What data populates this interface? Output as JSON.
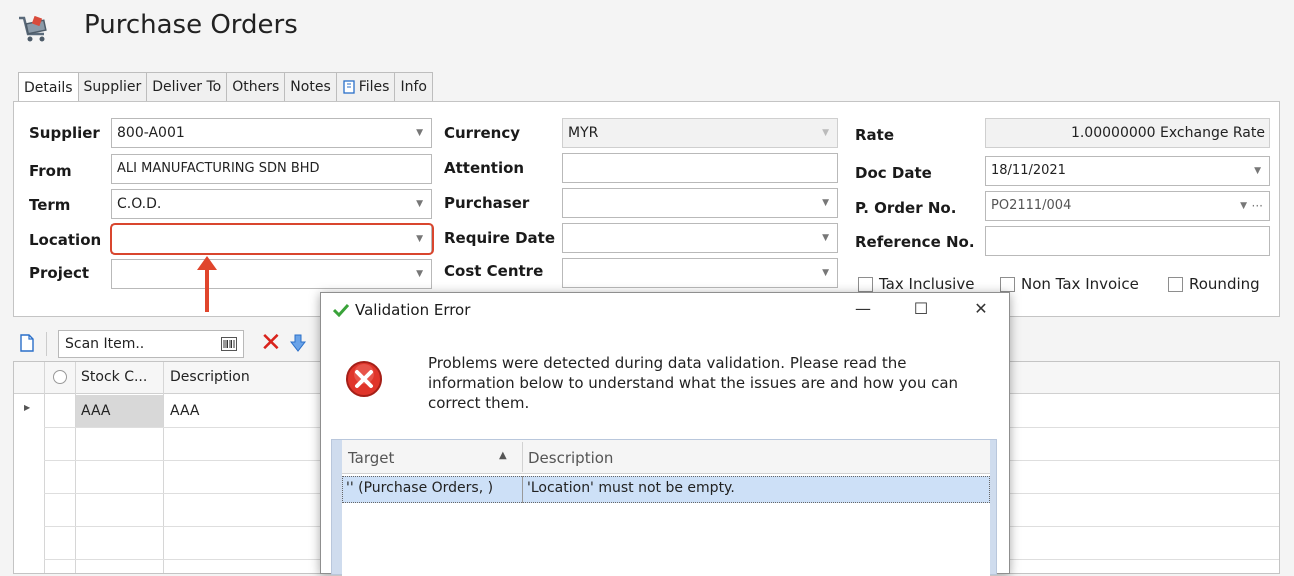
{
  "page": {
    "title": "Purchase Orders"
  },
  "tabs": [
    {
      "label": "Details",
      "active": true
    },
    {
      "label": "Supplier"
    },
    {
      "label": "Deliver To"
    },
    {
      "label": "Others"
    },
    {
      "label": "Notes"
    },
    {
      "label": "Files",
      "icon": "paperclip-icon"
    },
    {
      "label": "Info"
    }
  ],
  "form": {
    "supplier": {
      "label": "Supplier",
      "value": "800-A001"
    },
    "from": {
      "label": "From",
      "value": "ALI MANUFACTURING SDN BHD"
    },
    "term": {
      "label": "Term",
      "value": "C.O.D."
    },
    "location": {
      "label": "Location",
      "value": ""
    },
    "project": {
      "label": "Project",
      "value": ""
    },
    "currency": {
      "label": "Currency",
      "value": "MYR"
    },
    "attention": {
      "label": "Attention",
      "value": ""
    },
    "purchaser": {
      "label": "Purchaser",
      "value": ""
    },
    "require_date": {
      "label": "Require Date",
      "value": ""
    },
    "cost_centre": {
      "label": "Cost Centre",
      "value": ""
    },
    "rate": {
      "label": "Rate",
      "value": "1.00000000",
      "suffix": "Exchange Rate"
    },
    "doc_date": {
      "label": "Doc Date",
      "value": "18/11/2021"
    },
    "po_no": {
      "label": "P. Order No.",
      "value": "PO2111/004",
      "more": "···"
    },
    "reference_no": {
      "label": "Reference No.",
      "value": ""
    },
    "tax_inclusive": {
      "label": "Tax Inclusive",
      "checked": false
    },
    "non_tax_invoice": {
      "label": "Non Tax Invoice",
      "checked": false
    },
    "rounding": {
      "label": "Rounding",
      "checked": false
    }
  },
  "toolbar": {
    "scan_placeholder": "Scan Item.."
  },
  "grid": {
    "columns": [
      "Stock C...",
      "Description"
    ],
    "rows": [
      {
        "stock_code": "AAA",
        "description": "AAA"
      }
    ]
  },
  "dialog": {
    "title": "Validation Error",
    "minimize": "—",
    "maximize": "☐",
    "close": "✕",
    "message": "Problems were detected during data validation. Please read the information below to understand what the issues are and how you can correct them.",
    "columns": [
      "Target",
      "Description"
    ],
    "sort_indicator": "▲",
    "rows": [
      {
        "target": "'' (Purchase Orders, )",
        "description": "'Location' must not be empty."
      }
    ]
  },
  "colors": {
    "highlight": "#d9462e",
    "error": "#d9231c",
    "selected_row": "#cde0f7"
  }
}
